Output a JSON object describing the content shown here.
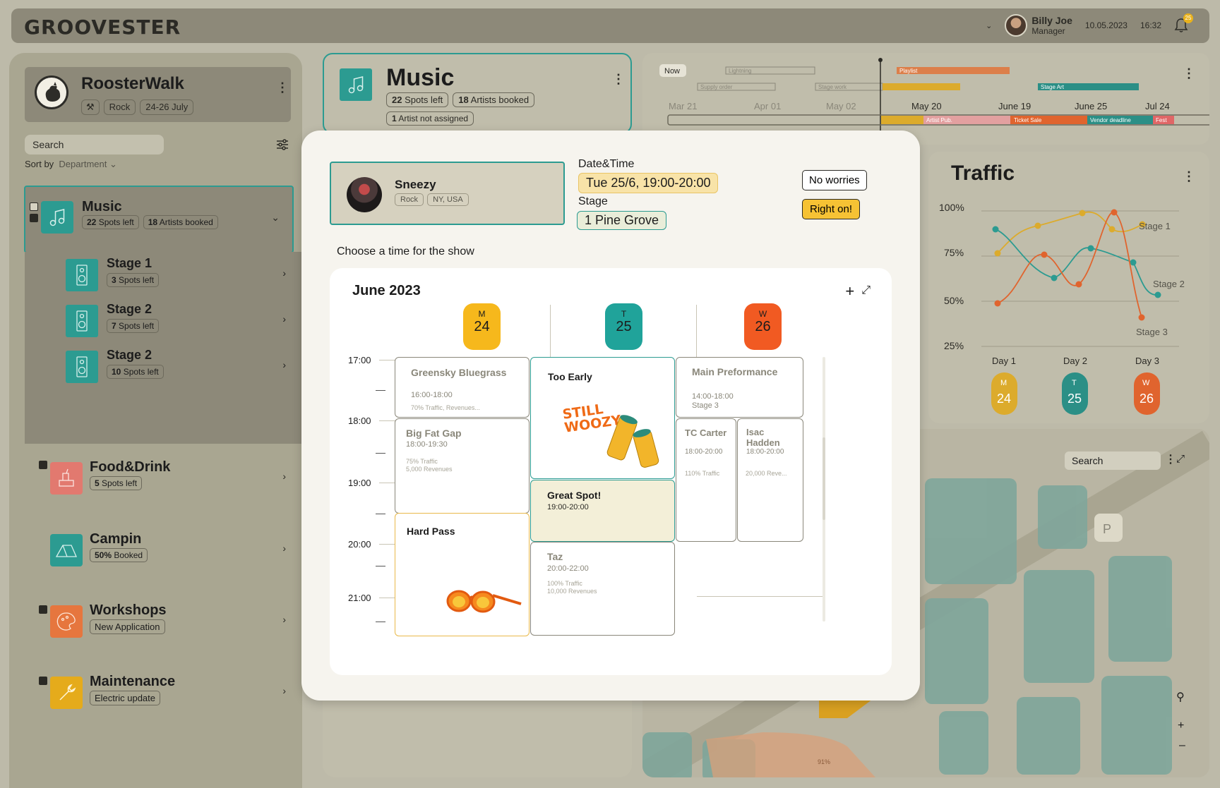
{
  "app": {
    "logo": "GROOVESTER"
  },
  "user": {
    "name": "Billy Joe",
    "role": "Manager",
    "date": "10.05.2023",
    "time": "16:32",
    "notifications": "25"
  },
  "event": {
    "name": "RoosterWalk",
    "genre": "Rock",
    "dates": "24-26 July"
  },
  "sidebar": {
    "search_placeholder": "Search",
    "sort_label": "Sort by",
    "sort_value": "Department",
    "departments": [
      {
        "name": "Music",
        "chip1_num": "22",
        "chip1_text": "Spots left",
        "chip2_num": "18",
        "chip2_text": "Artists booked",
        "color": "#2c9b91"
      },
      {
        "name": "Food&Drink",
        "chip1_num": "5",
        "chip1_text": "Spots left",
        "color": "#e2796f"
      },
      {
        "name": "Campin",
        "chip1_num": "50%",
        "chip1_text": "Booked",
        "color": "#2c9b91"
      },
      {
        "name": "Workshops",
        "chip1_text": "New Application",
        "color": "#e6763e"
      },
      {
        "name": "Maintenance",
        "chip1_text": "Electric update",
        "color": "#e5ab1b"
      }
    ],
    "stages": [
      {
        "name": "Stage 1",
        "num": "3",
        "text": "Spots left"
      },
      {
        "name": "Stage 2",
        "num": "7",
        "text": "Spots left"
      },
      {
        "name": "Stage 2",
        "num": "10",
        "text": "Spots left"
      }
    ]
  },
  "music_card": {
    "title": "Music",
    "spots_num": "22",
    "spots_text": "Spots left",
    "artists_num": "18",
    "artists_text": "Artists booked",
    "unassigned_num": "1",
    "unassigned_text": "Artist not assigned"
  },
  "timeline": {
    "now_label": "Now",
    "dates": [
      "Mar 21",
      "Apr 01",
      "May 02",
      "May 20",
      "June 19",
      "June 25",
      "Jul 24"
    ],
    "bars": [
      "Lightning",
      "Supply order",
      "Stage work",
      "Playlist",
      "Stage Art",
      "Artist Pub.",
      "Ticket Sale",
      "Vendor deadline",
      "Fest"
    ]
  },
  "traffic": {
    "title": "Traffic",
    "y_ticks": [
      "100%",
      "75%",
      "50%",
      "25%"
    ],
    "days": [
      "Day 1",
      "Day 2",
      "Day 3"
    ],
    "day_badges": [
      {
        "letter": "M",
        "num": "24"
      },
      {
        "letter": "T",
        "num": "25"
      },
      {
        "letter": "W",
        "num": "26"
      }
    ],
    "series_labels": [
      "Stage 1",
      "Stage 2",
      "Stage 3"
    ]
  },
  "map": {
    "search_placeholder": "Search",
    "parking": "P",
    "percent": "91%"
  },
  "modal": {
    "artist": {
      "name": "Sneezy",
      "genre": "Rock",
      "location": "NY, USA"
    },
    "datetime_label": "Date&Time",
    "datetime_value": "Tue 25/6, 19:00-20:00",
    "stage_label": "Stage",
    "stage_value": "1 Pine Grove",
    "btn_no": "No worries",
    "btn_yes": "Right on!",
    "choose_text": "Choose a time for the show",
    "calendar": {
      "title": "June 2023",
      "days": [
        {
          "letter": "M",
          "num": "24"
        },
        {
          "letter": "T",
          "num": "25"
        },
        {
          "letter": "W",
          "num": "26"
        }
      ],
      "hours": [
        "17:00",
        "18:00",
        "19:00",
        "20:00",
        "21:00"
      ],
      "slots": {
        "greensky": {
          "title": "Greensky Bluegrass",
          "time": "16:00-18:00",
          "meta": "70% Traffic, Revenues..."
        },
        "bigfat": {
          "title": "Big Fat Gap",
          "time": "18:00-19:30",
          "meta1": "75% Traffic",
          "meta2": "5,000 Revenues"
        },
        "hardpass": {
          "title": "Hard Pass"
        },
        "tooearly": {
          "title": "Too Early",
          "art": "STILL WOOZY"
        },
        "greatspot": {
          "title": "Great Spot!",
          "time": "19:00-20:00"
        },
        "taz": {
          "title": "Taz",
          "time": "20:00-22:00",
          "meta1": "100% Traffic",
          "meta2": "10,000 Revenues"
        },
        "main": {
          "title": "Main Preformance",
          "time": "14:00-18:00",
          "stage": "Stage 3"
        },
        "tccarter": {
          "title": "TC Carter",
          "time": "18:00-20:00",
          "meta": "110% Traffic"
        },
        "isac": {
          "title": "Isac Hadden",
          "time": "18:00-20:00",
          "meta": "20,000 Reve..."
        }
      }
    }
  },
  "colors": {
    "teal": "#2c9b91",
    "yellow": "#f6b81c",
    "orange": "#f15a22",
    "bg": "#bdbaa9"
  }
}
